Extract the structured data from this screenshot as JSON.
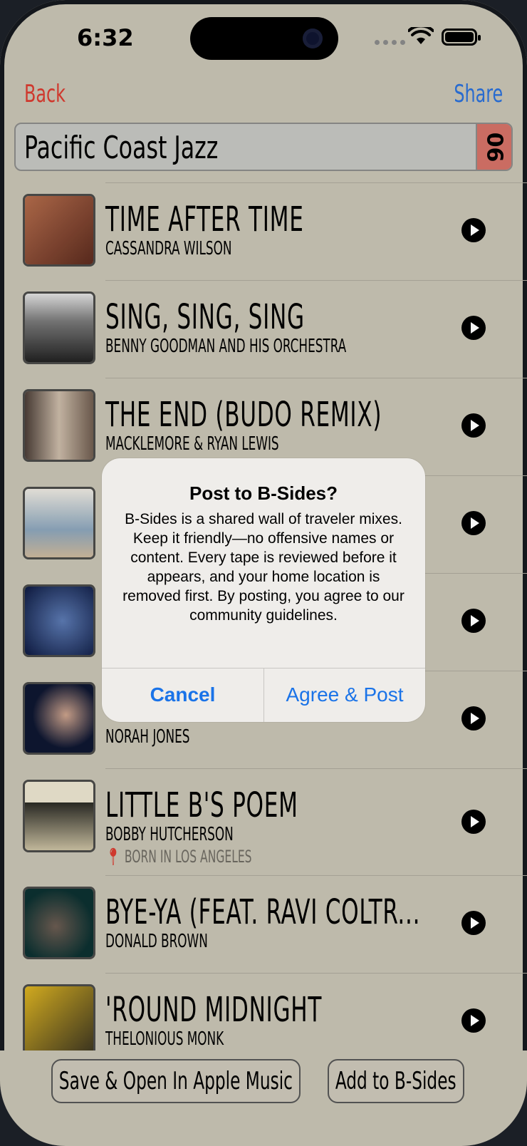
{
  "status": {
    "time": "6:32"
  },
  "nav": {
    "back": "Back",
    "share": "Share"
  },
  "mix": {
    "title": "Pacific Coast Jazz",
    "badge": "06"
  },
  "tracks": [
    {
      "title": "TIME AFTER TIME",
      "artist": "CASSANDRA WILSON",
      "location": "",
      "art_color": "#7a3a2a"
    },
    {
      "title": "SING, SING, SING",
      "artist": "BENNY GOODMAN AND HIS ORCHESTRA",
      "location": "",
      "art_color": "#444444"
    },
    {
      "title": "THE END (BUDO REMIX)",
      "artist": "MACKLEMORE & RYAN LEWIS",
      "location": "",
      "art_color": "#6e6154"
    },
    {
      "title": "",
      "artist": "",
      "location": "",
      "art_color": "#9cb0c0"
    },
    {
      "title": "",
      "artist": "",
      "location": "",
      "art_color": "#1d2f5c"
    },
    {
      "title": "",
      "artist": "NORAH JONES",
      "location": "",
      "art_color": "#14203a"
    },
    {
      "title": "LITTLE B'S POEM",
      "artist": "BOBBY HUTCHERSON",
      "location": "BORN IN LOS ANGELES",
      "art_color": "#d5ccb4"
    },
    {
      "title": "BYE-YA (FEAT. RAVI COLTR...",
      "artist": "DONALD BROWN",
      "location": "",
      "art_color": "#0f3a3a"
    },
    {
      "title": "'ROUND MIDNIGHT",
      "artist": "THELONIOUS MONK",
      "location": "",
      "art_color": "#c8a020"
    }
  ],
  "buttons": {
    "save": "Save & Open In Apple Music",
    "add": "Add to B-Sides"
  },
  "alert": {
    "title": "Post to B-Sides?",
    "message": "B-Sides is a shared wall of traveler mixes. Keep it friendly—no offensive names or content. Every tape is reviewed before it appears, and your home location is removed first. By posting, you agree to our community guidelines.",
    "cancel": "Cancel",
    "confirm": "Agree & Post"
  },
  "colors": {
    "background": "#c5c0b1",
    "back": "#d63a2f",
    "share": "#2a6fd6",
    "badge": "#d17066",
    "alert_action": "#1a73e8"
  },
  "icons": {
    "play": "play-icon",
    "pin": "location-pin-icon",
    "wifi": "wifi-icon",
    "battery": "battery-icon"
  }
}
